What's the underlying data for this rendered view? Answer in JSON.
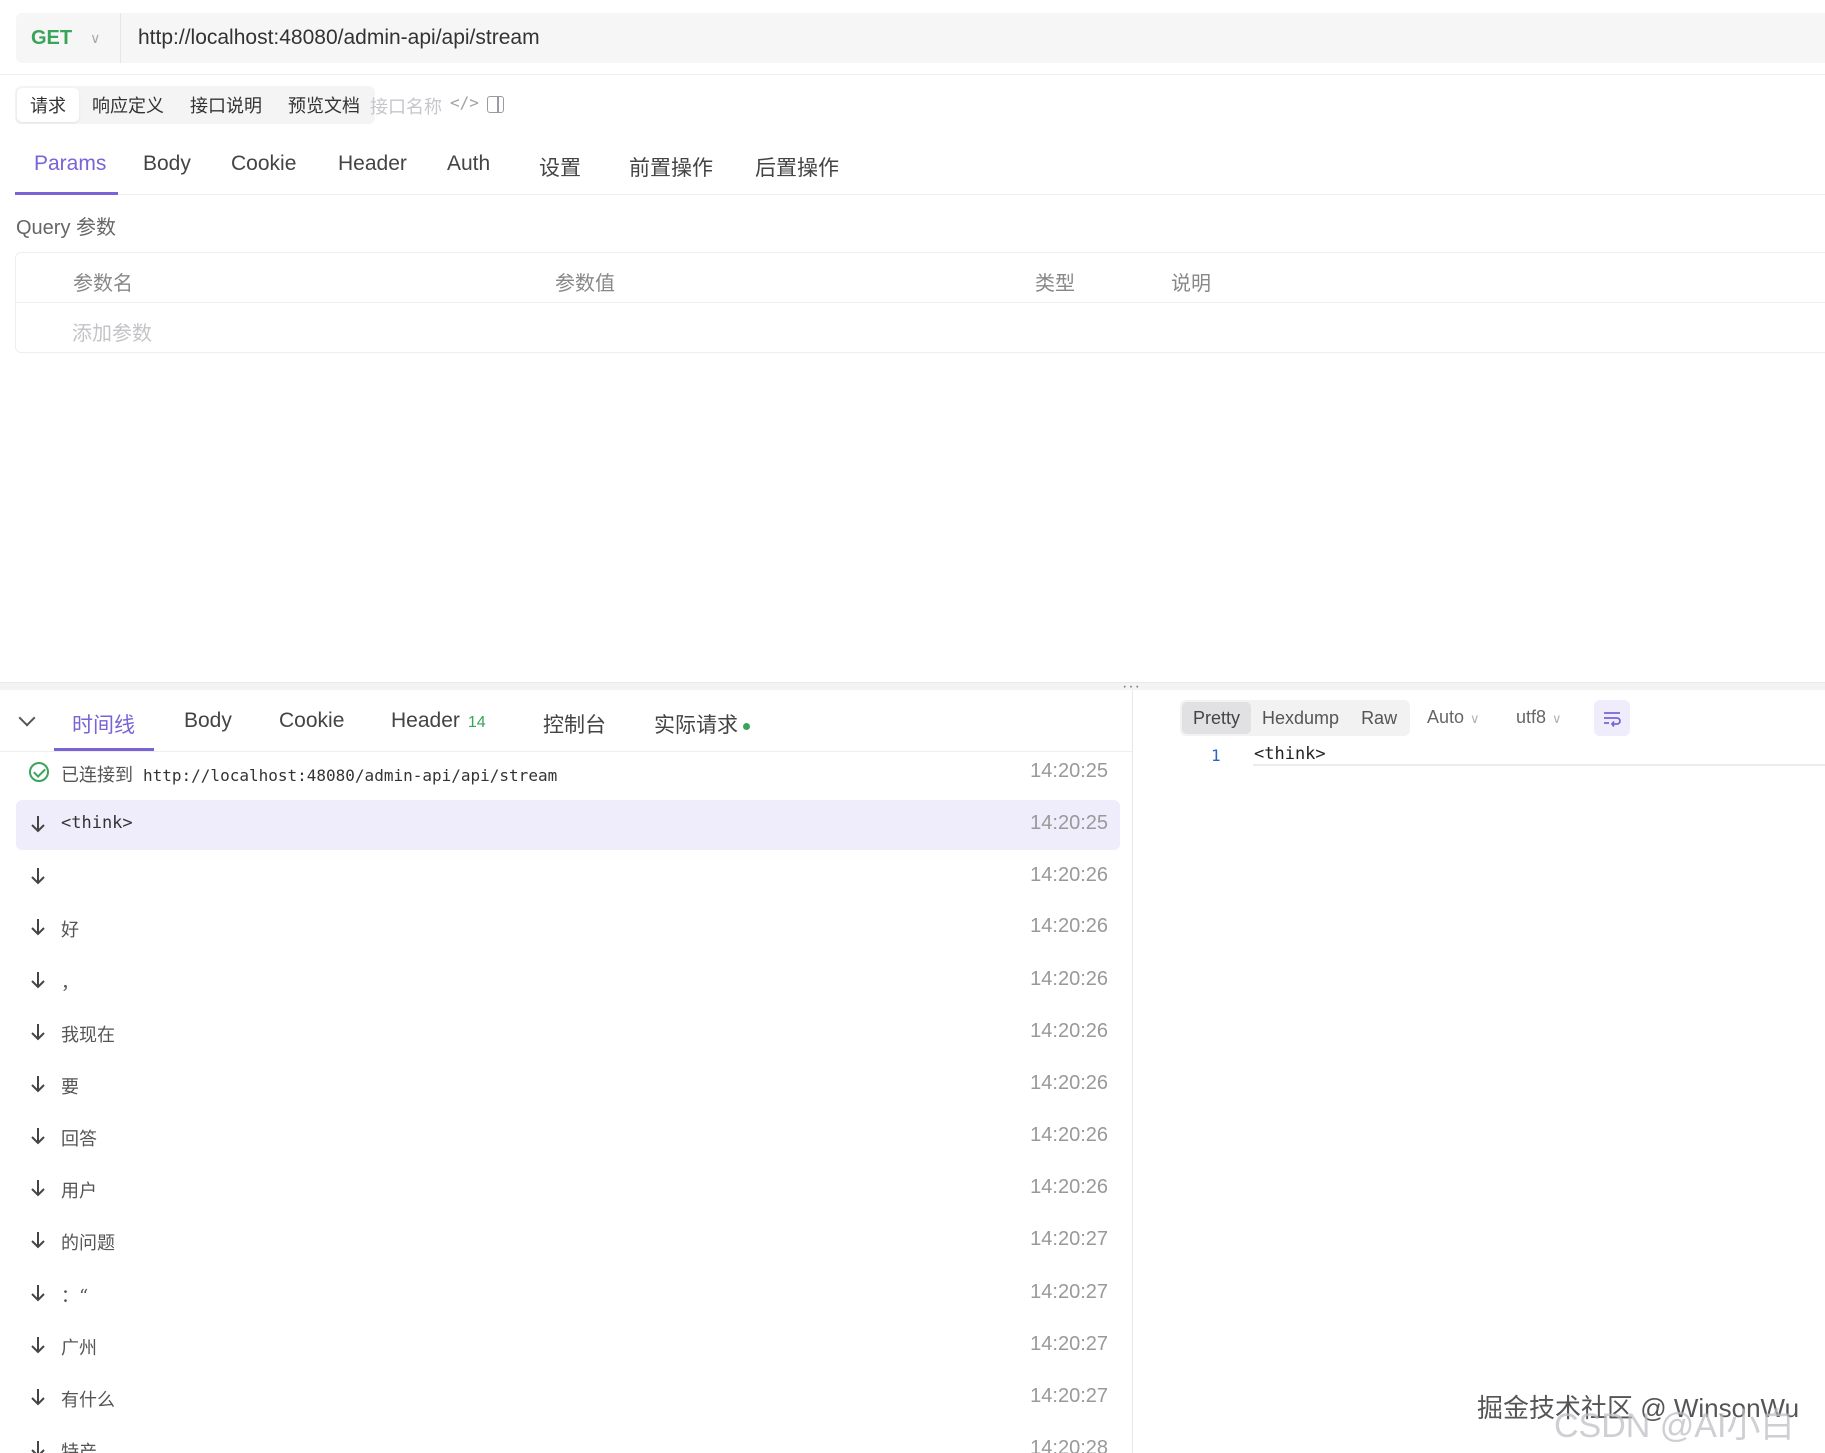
{
  "request": {
    "method": "GET",
    "url": "http://localhost:48080/admin-api/api/stream"
  },
  "segment_tabs": [
    "请求",
    "响应定义",
    "接口说明",
    "预览文档"
  ],
  "api_name_placeholder": "接口名称",
  "request_tabs": [
    "Params",
    "Body",
    "Cookie",
    "Header",
    "Auth",
    "设置",
    "前置操作",
    "后置操作"
  ],
  "query": {
    "title": "Query 参数",
    "columns": [
      "参数名",
      "参数值",
      "类型",
      "说明"
    ],
    "add_placeholder": "添加参数"
  },
  "response_tabs": {
    "timeline": "时间线",
    "body": "Body",
    "cookie": "Cookie",
    "header": "Header",
    "header_count": "14",
    "console": "控制台",
    "actual_request": "实际请求"
  },
  "timeline": [
    {
      "type": "connected",
      "prefix": "已连接到",
      "text": "http://localhost:48080/admin-api/api/stream",
      "time": "14:20:25"
    },
    {
      "type": "message",
      "text": "<think>",
      "time": "14:20:25",
      "selected": true
    },
    {
      "type": "message",
      "text": "",
      "time": "14:20:26"
    },
    {
      "type": "message",
      "text": "好",
      "time": "14:20:26"
    },
    {
      "type": "message",
      "text": "，",
      "time": "14:20:26"
    },
    {
      "type": "message",
      "text": "我现在",
      "time": "14:20:26"
    },
    {
      "type": "message",
      "text": "要",
      "time": "14:20:26"
    },
    {
      "type": "message",
      "text": "回答",
      "time": "14:20:26"
    },
    {
      "type": "message",
      "text": "用户",
      "time": "14:20:26"
    },
    {
      "type": "message",
      "text": "的问题",
      "time": "14:20:27"
    },
    {
      "type": "message",
      "text": "：“",
      "time": "14:20:27"
    },
    {
      "type": "message",
      "text": "广州",
      "time": "14:20:27"
    },
    {
      "type": "message",
      "text": "有什么",
      "time": "14:20:27"
    },
    {
      "type": "message",
      "text": "特产",
      "time": "14:20:28"
    }
  ],
  "viewer": {
    "formats": [
      "Pretty",
      "Hexdump",
      "Raw"
    ],
    "active_format": "Pretty",
    "mode": "Auto",
    "encoding": "utf8",
    "line_number": "1",
    "content": "<think>"
  },
  "watermark": {
    "line1": "掘金技术社区 @ WinsonWu",
    "line2": "CSDN @AI小白熊"
  },
  "colors": {
    "accent": "#7a63d6",
    "get_method": "#3aa45a",
    "selected_row": "#efedfb"
  }
}
